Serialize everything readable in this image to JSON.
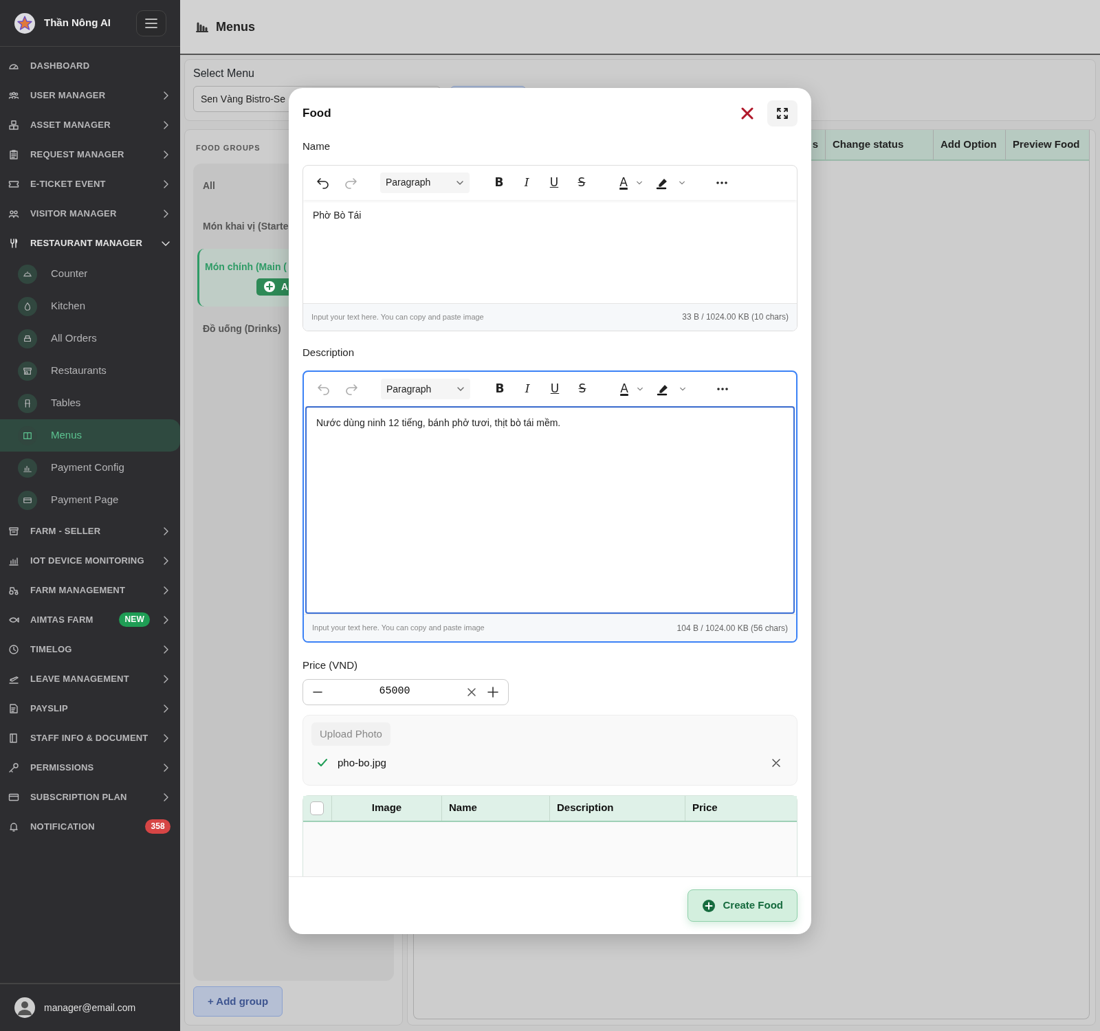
{
  "sidebar": {
    "brand": "Thần Nông AI",
    "items": [
      {
        "label": "DASHBOARD",
        "expandable": false,
        "expanded": false
      },
      {
        "label": "USER MANAGER",
        "expandable": true,
        "expanded": false
      },
      {
        "label": "ASSET MANAGER",
        "expandable": true,
        "expanded": false
      },
      {
        "label": "REQUEST MANAGER",
        "expandable": true,
        "expanded": false
      },
      {
        "label": "E-TICKET EVENT",
        "expandable": true,
        "expanded": false
      },
      {
        "label": "VISITOR MANAGER",
        "expandable": true,
        "expanded": false
      },
      {
        "label": "RESTAURANT MANAGER",
        "expandable": true,
        "expanded": true,
        "children": [
          {
            "label": "Counter",
            "selected": false
          },
          {
            "label": "Kitchen",
            "selected": false
          },
          {
            "label": "All Orders",
            "selected": false
          },
          {
            "label": "Restaurants",
            "selected": false
          },
          {
            "label": "Tables",
            "selected": false
          },
          {
            "label": "Menus",
            "selected": true
          },
          {
            "label": "Payment Config",
            "selected": false
          },
          {
            "label": "Payment Page",
            "selected": false
          }
        ]
      },
      {
        "label": "FARM - SELLER",
        "expandable": true,
        "expanded": false
      },
      {
        "label": "IOT DEVICE MONITORING",
        "expandable": true,
        "expanded": false
      },
      {
        "label": "FARM MANAGEMENT",
        "expandable": true,
        "expanded": false
      },
      {
        "label": "AIMTAS FARM",
        "expandable": true,
        "expanded": false,
        "badge": {
          "text": "NEW",
          "color": "#1f9d55"
        }
      },
      {
        "label": "TIMELOG",
        "expandable": true,
        "expanded": false
      },
      {
        "label": "LEAVE MANAGEMENT",
        "expandable": true,
        "expanded": false
      },
      {
        "label": "PAYSLIP",
        "expandable": true,
        "expanded": false
      },
      {
        "label": "STAFF INFO & DOCUMENT",
        "expandable": true,
        "expanded": false
      },
      {
        "label": "PERMISSIONS",
        "expandable": true,
        "expanded": false
      },
      {
        "label": "SUBSCRIPTION PLAN",
        "expandable": true,
        "expanded": false
      },
      {
        "label": "NOTIFICATION",
        "expandable": false,
        "expanded": false,
        "badge": {
          "text": "358",
          "color": "#d64545"
        }
      }
    ],
    "user": "manager@email.com"
  },
  "header": {
    "title": "Menus"
  },
  "select_menu": {
    "label": "Select Menu",
    "value": "Sen Vàng Bistro-Se"
  },
  "food_groups": {
    "heading": "FOOD GROUPS",
    "items": [
      {
        "label": "All",
        "selected": false
      },
      {
        "label": "Món khai vị (Starte",
        "selected": false
      },
      {
        "label": "Món chính (Main (",
        "selected": true,
        "add_button": "A"
      },
      {
        "label": "Đồ uống (Drinks)",
        "selected": false
      }
    ],
    "add_button": "+ Add group"
  },
  "food_table": {
    "columns": [
      "s",
      "Change status",
      "Add Option",
      "Preview Food"
    ]
  },
  "modal": {
    "title": "Food",
    "editors": [
      {
        "label": "Name",
        "value": "Phờ Bò Tái",
        "focused": false,
        "can_undo": true,
        "can_redo": false,
        "block_style": "Paragraph",
        "format_buttons": [
          "B",
          "I",
          "U",
          "S",
          "A"
        ],
        "hint": "Input your text here. You can copy and paste image",
        "size": "33 B / 1024.00 KB (10 chars)"
      },
      {
        "label": "Description",
        "value": "Nước dùng ninh 12 tiếng, bánh phở tươi, thịt bò tái mềm.",
        "focused": true,
        "can_undo": false,
        "can_redo": false,
        "block_style": "Paragraph",
        "format_buttons": [
          "B",
          "I",
          "U",
          "S",
          "A"
        ],
        "hint": "Input your text here. You can copy and paste image",
        "size": "104 B / 1024.00 KB (56 chars)"
      }
    ],
    "price": {
      "label": "Price (VND)",
      "value": "65000"
    },
    "upload": {
      "button": "Upload Photo",
      "files": [
        {
          "name": "pho-bo.jpg",
          "done": true
        }
      ]
    },
    "table": {
      "select_all": false,
      "columns": [
        "Image",
        "Name",
        "Description",
        "Price"
      ]
    },
    "submit": "Create Food"
  }
}
